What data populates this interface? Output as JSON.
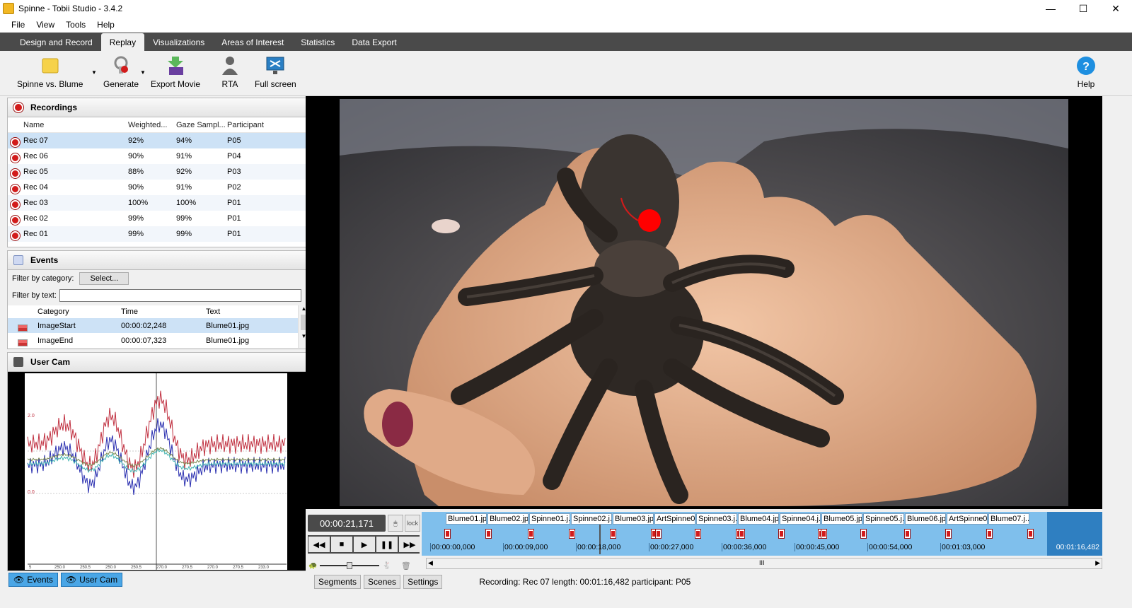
{
  "window": {
    "title": "Spinne - Tobii Studio - 3.4.2",
    "minimize": "—",
    "maximize": "☐",
    "close": "✕"
  },
  "menu": [
    "File",
    "View",
    "Tools",
    "Help"
  ],
  "tabs": [
    "Design and Record",
    "Replay",
    "Visualizations",
    "Areas of Interest",
    "Statistics",
    "Data Export"
  ],
  "toolbar": {
    "test_label": "Spinne vs. Blume",
    "generate_label": "Generate",
    "export_label": "Export Movie",
    "rta_label": "RTA",
    "fullscreen_label": "Full screen",
    "help_label": "Help"
  },
  "recordings": {
    "title": "Recordings",
    "columns": [
      "Name",
      "Weighted...",
      "Gaze Sampl...",
      "Participant"
    ],
    "rows": [
      {
        "name": "Rec 07",
        "weighted": "92%",
        "gaze": "94%",
        "participant": "P05"
      },
      {
        "name": "Rec 06",
        "weighted": "90%",
        "gaze": "91%",
        "participant": "P04"
      },
      {
        "name": "Rec 05",
        "weighted": "88%",
        "gaze": "92%",
        "participant": "P03"
      },
      {
        "name": "Rec 04",
        "weighted": "90%",
        "gaze": "91%",
        "participant": "P02"
      },
      {
        "name": "Rec 03",
        "weighted": "100%",
        "gaze": "100%",
        "participant": "P01"
      },
      {
        "name": "Rec 02",
        "weighted": "99%",
        "gaze": "99%",
        "participant": "P01"
      },
      {
        "name": "Rec 01",
        "weighted": "99%",
        "gaze": "99%",
        "participant": "P01"
      }
    ]
  },
  "events": {
    "title": "Events",
    "filter_category_label": "Filter by category:",
    "select_label": "Select...",
    "filter_text_label": "Filter by text:",
    "columns": [
      "Category",
      "Time",
      "Text"
    ],
    "rows": [
      {
        "category": "ImageStart",
        "time": "00:00:02,248",
        "text": "Blume01.jpg"
      },
      {
        "category": "ImageEnd",
        "time": "00:00:07,323",
        "text": "Blume01.jpg"
      }
    ]
  },
  "usercam": {
    "title": "User Cam",
    "ylabels": [
      "2.0",
      "0.0"
    ],
    "xlabels": [
      "5",
      "250.0",
      "250.5",
      "250.0",
      "250.5",
      "270.0",
      "270.5",
      "270.0",
      "270.5",
      "233.0"
    ]
  },
  "view_toggles": [
    "Events",
    "User Cam"
  ],
  "player": {
    "current_time": "00:00:21,171",
    "lock_label": "lock",
    "scenes": [
      "Blume01.jpg",
      "Blume02.jpg",
      "Spinne01.j...",
      "Spinne02.j...",
      "Blume03.jpg",
      "ArtSpinne0...",
      "Spinne03.j...",
      "Blume04.jpg",
      "Spinne04.j...",
      "Blume05.jpg",
      "Spinne05.j...",
      "Blume06.jpg",
      "ArtSpinne0...",
      "Blume07.j..."
    ],
    "ticks": [
      "00:00:00,000",
      "00:00:09,000",
      "00:00:18,000",
      "00:00:27,000",
      "00:00:36,000",
      "00:00:45,000",
      "00:00:54,000",
      "00:01:03,000"
    ],
    "end_time": "00:01:16,482",
    "bottom_buttons": [
      "Segments",
      "Scenes",
      "Settings"
    ],
    "status": "Recording: Rec 07 length: 00:01:16,482 participant: P05",
    "scroll_mark": "III"
  }
}
